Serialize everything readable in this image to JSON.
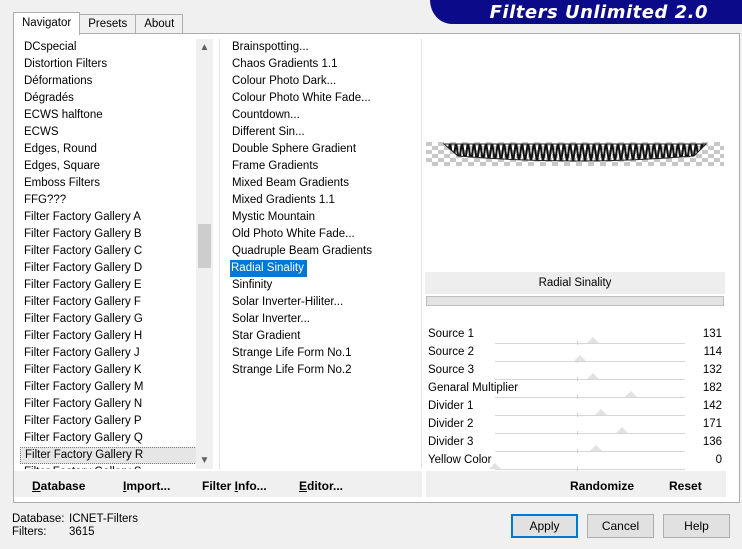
{
  "tabs": [
    "Navigator",
    "Presets",
    "About"
  ],
  "banner_title": "Filters Unlimited 2.0",
  "categories": [
    "DCspecial",
    "Distortion Filters",
    "Déformations",
    "Dégradés",
    "ECWS halftone",
    "ECWS",
    "Edges, Round",
    "Edges, Square",
    "Emboss Filters",
    "FFG???",
    "Filter Factory Gallery A",
    "Filter Factory Gallery B",
    "Filter Factory Gallery C",
    "Filter Factory Gallery D",
    "Filter Factory Gallery E",
    "Filter Factory Gallery F",
    "Filter Factory Gallery G",
    "Filter Factory Gallery H",
    "Filter Factory Gallery J",
    "Filter Factory Gallery K",
    "Filter Factory Gallery M",
    "Filter Factory Gallery N",
    "Filter Factory Gallery P",
    "Filter Factory Gallery Q",
    "Filter Factory Gallery R",
    "Filter Factory Gallery S"
  ],
  "selected_category_index": 24,
  "filters": [
    "Brainspotting...",
    "Chaos Gradients 1.1",
    "Colour Photo Dark...",
    "Colour Photo White Fade...",
    "Countdown...",
    "Different Sin...",
    "Double Sphere Gradient",
    "Frame Gradients",
    "Mixed Beam Gradients",
    "Mixed Gradients 1.1",
    "Mystic Mountain",
    "Old Photo White Fade...",
    "Quadruple Beam Gradients",
    "Radial Sinality",
    "Sinfinity",
    "Solar Inverter-Hiliter...",
    "Solar Inverter...",
    "Star Gradient",
    "Strange Life Form No.1",
    "Strange Life Form No.2"
  ],
  "selected_filter_index": 13,
  "selected_filter_name": "Radial Sinality",
  "parameters": [
    {
      "name": "Source 1",
      "value": "131",
      "level": 0.514
    },
    {
      "name": "Source 2",
      "value": "114",
      "level": 0.447
    },
    {
      "name": "Source 3",
      "value": "132",
      "level": 0.518
    },
    {
      "name": "Genaral Multiplier",
      "value": "182",
      "level": 0.714
    },
    {
      "name": "Divider 1",
      "value": "142",
      "level": 0.557
    },
    {
      "name": "Divider 2",
      "value": "171",
      "level": 0.671
    },
    {
      "name": "Divider 3",
      "value": "136",
      "level": 0.533
    },
    {
      "name": "Yellow Color",
      "value": "0",
      "level": 0
    }
  ],
  "left_buttons": [
    {
      "label": "Database",
      "ul": "D"
    },
    {
      "label": "Import...",
      "ul": "I"
    },
    {
      "label": "Filter Info...",
      "ul": "I"
    },
    {
      "label": "Editor...",
      "ul": "E"
    }
  ],
  "randomize_label": "Randomize",
  "reset_label": "Reset",
  "footer": {
    "database_label": "Database:",
    "database_value": "ICNET-Filters",
    "filters_label": "Filters:",
    "filters_value": "3615"
  },
  "dialog_buttons": {
    "apply": "Apply",
    "cancel": "Cancel",
    "help": "Help"
  },
  "colors": {
    "banner": "#0b0b8a",
    "selection": "#0078d7",
    "default_button_border": "#0078d7"
  }
}
